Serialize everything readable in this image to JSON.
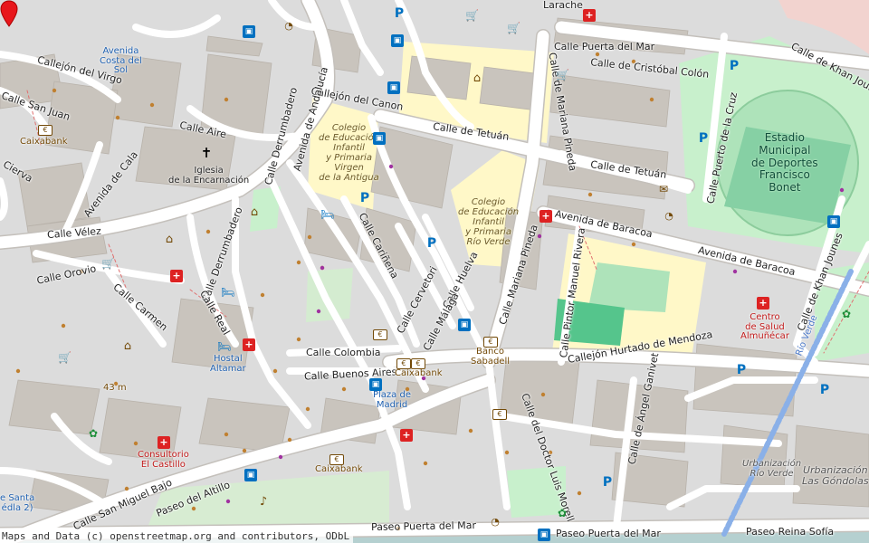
{
  "attribution": "Maps and Data (c) openstreetmap.org and contributors, ODbL",
  "streets": [
    {
      "name": "Calle Puerta del Mar"
    },
    {
      "name": "Calle de Cristóbal Colón"
    },
    {
      "name": "Calle de Khan Jounes"
    },
    {
      "name": "Calle de Tetuán"
    },
    {
      "name": "Calle de Tetuán"
    },
    {
      "name": "Calle de Mariana Pineda"
    },
    {
      "name": "Calle Mariana Pineda"
    },
    {
      "name": "Calle Puerto de la Cruz"
    },
    {
      "name": "Avenida de Baracoa"
    },
    {
      "name": "Avenida de Baracoa"
    },
    {
      "name": "Calle de Khan Jounes"
    },
    {
      "name": "Callejón del Canon"
    },
    {
      "name": "Avenida de Andalucía"
    },
    {
      "name": "Calle Derrumbadero"
    },
    {
      "name": "Calle Derrumbadero"
    },
    {
      "name": "Calle Aire"
    },
    {
      "name": "Callejón del Virgo"
    },
    {
      "name": "Avenida de Cala"
    },
    {
      "name": "Calle Vélez"
    },
    {
      "name": "Calle Orovio"
    },
    {
      "name": "Calle Carmen"
    },
    {
      "name": "Calle Real"
    },
    {
      "name": "Calle Cariñena"
    },
    {
      "name": "Calle Cervetori"
    },
    {
      "name": "Calle Huelva"
    },
    {
      "name": "Calle Málaga"
    },
    {
      "name": "Calle Colombia"
    },
    {
      "name": "Calle Buenos Aires"
    },
    {
      "name": "Calle Pintor Manuel Rivera"
    },
    {
      "name": "Callejón Hurtado de Mendoza"
    },
    {
      "name": "Calle del Doctor Luis Morell"
    },
    {
      "name": "Calle de Ángel Ganivet"
    },
    {
      "name": "Calle San Miguel Bajo"
    },
    {
      "name": "Paseo del Altillo"
    },
    {
      "name": "Paseo Puerta del Mar"
    },
    {
      "name": "Paseo Puerta del Mar"
    },
    {
      "name": "Paseo Reina Sofía"
    },
    {
      "name": "Calle San Juan"
    },
    {
      "name": "Cierva"
    },
    {
      "name": "Larache"
    },
    {
      "name": "Río Verde"
    }
  ],
  "places": {
    "avenida_costa": "Avenida\nCosta del\nSol",
    "caixabank_1": "Caixabank",
    "iglesia": "Iglesia\nde la Encarnación",
    "colegio_antigua": "Colegio\nde Educación\nInfantil\ny Primaria\nVirgen\nde la Antigua",
    "colegio_rio": "Colegio\nde Educación\nInfantil\ny Primaria\nRío Verde",
    "estadio": "Estadio\nMunicipal\nde Deportes\nFrancisco\nBonet",
    "centro_salud": "Centro\nde Salud\nAlmuñécar",
    "banco_sabadell": "Banco\nSabadell",
    "caixabank_2": "Caixabank",
    "plaza_madrid": "Plaza de\nMadrid",
    "hostal": "Hostal\nAltamar",
    "consultorio": "Consultorio\nEl Castillo",
    "caixabank_3": "Caixabank",
    "urb_rio": "Urbanización\nRío Verde",
    "urb_gondolas": "Urbanización\nLas Góndolas",
    "elevation": "43 m",
    "santa": "e Santa\nédla 2)"
  },
  "icons": {
    "bus": "bus-stop-icon",
    "parking": "P",
    "pharmacy": "+",
    "bank": "€",
    "shop": "🛒",
    "museum": "⌂",
    "hotel": "🛏",
    "church": "✝",
    "post": "✉",
    "music": "♪",
    "hospital": "+"
  },
  "marker": {
    "name": "location-pin",
    "color": "#e8161b"
  },
  "colors": {
    "land": "#dcdcdc",
    "road": "#ffffff",
    "school": "#fff8c8",
    "park": "#c8f0cc",
    "stadium": "#aee3ba",
    "pitch": "#86d0a4",
    "building": "#c9c4bd",
    "sea": "#b5d0d0"
  }
}
